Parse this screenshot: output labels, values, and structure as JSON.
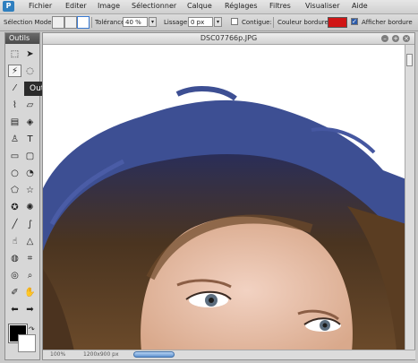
{
  "menubar": {
    "logo": "P",
    "items": [
      "Fichier",
      "Editer",
      "Image",
      "Sélectionner",
      "Calque",
      "Réglages",
      "Filtres",
      "Visualiser",
      "Aide"
    ]
  },
  "options": {
    "selection_mode_label": "Sélection Mode:",
    "tolerance_label": "Tolérance:",
    "tolerance_value": "40 %",
    "smoothing_label": "Lissage:",
    "smoothing_value": "0 px",
    "contiguous_label": "Contigue:",
    "contiguous_checked": false,
    "border_color_label": "Couleur bordure:",
    "border_color": "#d01515",
    "show_border_label": "Afficher bordure",
    "show_border_checked": true
  },
  "toolbox": {
    "title": "Outils",
    "tooltip": "Outil Baguette magique",
    "tools": [
      "rectangle-select-icon",
      "move-icon",
      "magic-wand-icon",
      "lasso-icon",
      "eyedropper-icon",
      "pencil-icon",
      "brush-icon",
      "eraser-icon",
      "gradient-icon",
      "bucket-icon",
      "stamp-icon",
      "text-icon",
      "rectangle-icon",
      "rounded-rectangle-icon",
      "ellipse-icon",
      "custom-shape-icon",
      "polygon-icon",
      "star-icon",
      "badge-icon",
      "flower-icon",
      "line-icon",
      "curve-icon",
      "smudge-icon",
      "sharpen-icon",
      "blur-icon",
      "crop-icon",
      "sponge-icon",
      "zoom-icon",
      "color-replace-icon",
      "hand-icon",
      "arrow-left-icon",
      "arrow-right-icon"
    ]
  },
  "colors": {
    "foreground": "#000000",
    "background": "#ffffff"
  },
  "document": {
    "title": "DSC07766p.JPG",
    "zoom": "100%",
    "dimensions": "1200x900 px"
  }
}
